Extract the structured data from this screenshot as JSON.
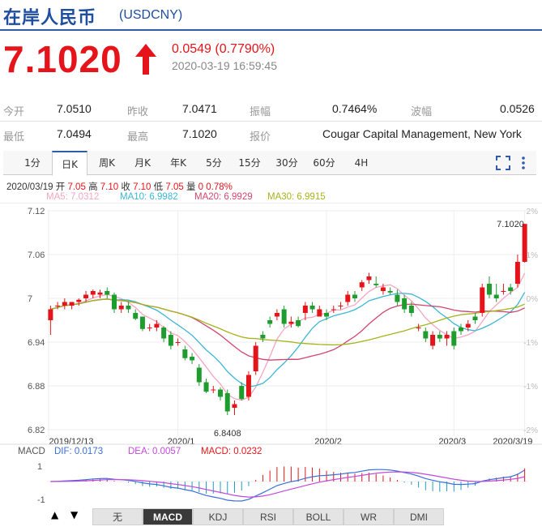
{
  "header": {
    "title": "在岸人民币",
    "code": "(USDCNY)"
  },
  "quote": {
    "price": "7.1020",
    "change": "0.0549 (0.7790%)",
    "time": "2020-03-19 16:59:45",
    "direction": "up",
    "up_color": "#e5141a"
  },
  "stats": {
    "row1": [
      {
        "label": "今开",
        "value": "7.0510"
      },
      {
        "label": "昨收",
        "value": "7.0471"
      },
      {
        "label": "振幅",
        "value": "0.7464%"
      },
      {
        "label": "波幅",
        "value": "0.0526"
      }
    ],
    "row2": [
      {
        "label": "最低",
        "value": "7.0494"
      },
      {
        "label": "最高",
        "value": "7.1020"
      },
      {
        "label": "报价",
        "value": "Cougar Capital Management, New York"
      }
    ]
  },
  "tabs": [
    "1分",
    "日K",
    "周K",
    "月K",
    "年K",
    "5分",
    "15分",
    "30分",
    "60分",
    "4H"
  ],
  "active_tab": "日K",
  "tools": {
    "fullscreen": "fullscreen-icon",
    "more": "more-vertical-icon"
  },
  "info_line": {
    "date": "2020/03/19",
    "open_label": "开",
    "open": "7.05",
    "high_label": "高",
    "high": "7.10",
    "close_label": "收",
    "close": "7.10",
    "low_label": "低",
    "low": "7.05",
    "vol_label": "量",
    "vol": "0",
    "pct": "0.78%"
  },
  "ma_legend": [
    {
      "text": "MA5: 7.0312",
      "color": "#f4a6c0"
    },
    {
      "text": "MA10: 6.9982",
      "color": "#3cb6d6"
    },
    {
      "text": "MA20: 6.9929",
      "color": "#d2466e"
    },
    {
      "text": "MA30: 6.9915",
      "color": "#a6b21b"
    }
  ],
  "chart_data": {
    "type": "candlestick",
    "y_ticks": [
      "7.12",
      "7.06",
      "7",
      "6.94",
      "6.88",
      "6.82"
    ],
    "y_right_ticks": [
      "2%",
      "1%",
      "0%",
      "-1%",
      "-1%",
      "-2%"
    ],
    "x_labels": [
      "2019/12/13",
      "2020/1",
      "2020/2",
      "2020/3",
      "2020/3/19"
    ],
    "annotations": {
      "high": "7.1020",
      "low": "6.8408"
    },
    "ylim": [
      6.82,
      7.12
    ],
    "candles": [
      [
        6.97,
        6.99,
        6.95,
        6.985
      ],
      [
        6.99,
        6.995,
        6.985,
        6.99
      ],
      [
        6.99,
        7.0,
        6.985,
        6.995
      ],
      [
        6.99,
        6.995,
        6.985,
        6.995
      ],
      [
        6.995,
        7.0,
        6.99,
        6.998
      ],
      [
        7.0,
        7.01,
        6.995,
        7.005
      ],
      [
        7.005,
        7.012,
        7.0,
        7.01
      ],
      [
        7.005,
        7.012,
        7.0,
        7.008
      ],
      [
        7.01,
        7.015,
        7.0,
        7.005
      ],
      [
        7.005,
        7.008,
        6.98,
        6.985
      ],
      [
        6.985,
        6.995,
        6.98,
        6.99
      ],
      [
        6.99,
        6.995,
        6.98,
        6.985
      ],
      [
        6.98,
        6.985,
        6.97,
        6.972
      ],
      [
        6.975,
        6.975,
        6.955,
        6.958
      ],
      [
        6.96,
        6.965,
        6.955,
        6.96
      ],
      [
        6.96,
        6.97,
        6.955,
        6.965
      ],
      [
        6.96,
        6.962,
        6.94,
        6.945
      ],
      [
        6.95,
        6.955,
        6.93,
        6.935
      ],
      [
        6.94,
        6.945,
        6.935,
        6.94
      ],
      [
        6.93,
        6.935,
        6.915,
        6.918
      ],
      [
        6.92,
        6.925,
        6.91,
        6.915
      ],
      [
        6.905,
        6.91,
        6.88,
        6.885
      ],
      [
        6.885,
        6.89,
        6.87,
        6.872
      ],
      [
        6.875,
        6.88,
        6.87,
        6.875
      ],
      [
        6.875,
        6.878,
        6.86,
        6.865
      ],
      [
        6.87,
        6.875,
        6.84,
        6.845
      ],
      [
        6.85,
        6.86,
        6.84,
        6.855
      ],
      [
        6.88,
        6.885,
        6.86,
        6.862
      ],
      [
        6.865,
        6.9,
        6.86,
        6.895
      ],
      [
        6.9,
        6.94,
        6.895,
        6.935
      ],
      [
        6.95,
        6.955,
        6.94,
        6.945
      ],
      [
        6.97,
        6.975,
        6.96,
        6.965
      ],
      [
        6.975,
        6.985,
        6.97,
        6.98
      ],
      [
        6.985,
        6.99,
        6.96,
        6.965
      ],
      [
        6.965,
        6.975,
        6.96,
        6.968
      ],
      [
        6.97,
        6.975,
        6.96,
        6.962
      ],
      [
        6.98,
        6.995,
        6.97,
        6.99
      ],
      [
        6.99,
        6.995,
        6.98,
        6.985
      ],
      [
        6.975,
        6.99,
        6.975,
        6.985
      ],
      [
        6.98,
        6.985,
        6.97,
        6.975
      ],
      [
        6.985,
        6.99,
        6.98,
        6.985
      ],
      [
        6.99,
        6.995,
        6.985,
        6.99
      ],
      [
        6.995,
        7.01,
        6.99,
        7.005
      ],
      [
        7.005,
        7.01,
        6.995,
        7.0
      ],
      [
        7.015,
        7.025,
        7.01,
        7.022
      ],
      [
        7.025,
        7.035,
        7.02,
        7.03
      ],
      [
        7.02,
        7.03,
        7.015,
        7.018
      ],
      [
        7.01,
        7.02,
        7.005,
        7.015
      ],
      [
        7.01,
        7.015,
        7.005,
        7.008
      ],
      [
        7.005,
        7.012,
        6.99,
        6.995
      ],
      [
        7.0,
        7.005,
        6.98,
        6.985
      ],
      [
        6.99,
        6.995,
        6.975,
        6.98
      ],
      [
        6.96,
        6.965,
        6.955,
        6.96
      ],
      [
        6.955,
        6.96,
        6.94,
        6.945
      ],
      [
        6.935,
        6.955,
        6.93,
        6.95
      ],
      [
        6.95,
        6.955,
        6.94,
        6.945
      ],
      [
        6.945,
        6.955,
        6.935,
        6.95
      ],
      [
        6.955,
        6.96,
        6.93,
        6.935
      ],
      [
        6.96,
        6.965,
        6.95,
        6.955
      ],
      [
        6.96,
        6.97,
        6.955,
        6.965
      ],
      [
        6.975,
        6.98,
        6.965,
        6.97
      ],
      [
        6.98,
        7.02,
        6.975,
        7.015
      ],
      [
        7.02,
        7.03,
        7.0,
        7.005
      ],
      [
        7.005,
        7.02,
        6.995,
        7.0
      ],
      [
        7.01,
        7.02,
        7.005,
        7.01
      ],
      [
        7.015,
        7.02,
        7.005,
        7.01
      ],
      [
        7.02,
        7.06,
        7.015,
        7.05
      ],
      [
        7.05,
        7.102,
        7.049,
        7.102
      ]
    ]
  },
  "macd": {
    "label": "MACD",
    "dif": "DIF: 0.0173",
    "dea": "DEA: 0.0057",
    "macd": "MACD: 0.0232",
    "y_ticks": [
      "1",
      "-1"
    ]
  },
  "bottom_tabs": [
    "无",
    "MACD",
    "KDJ",
    "RSI",
    "BOLL",
    "WR",
    "DMI"
  ],
  "bottom_active": "MACD",
  "nav": {
    "up": "▲",
    "down": "▼"
  }
}
